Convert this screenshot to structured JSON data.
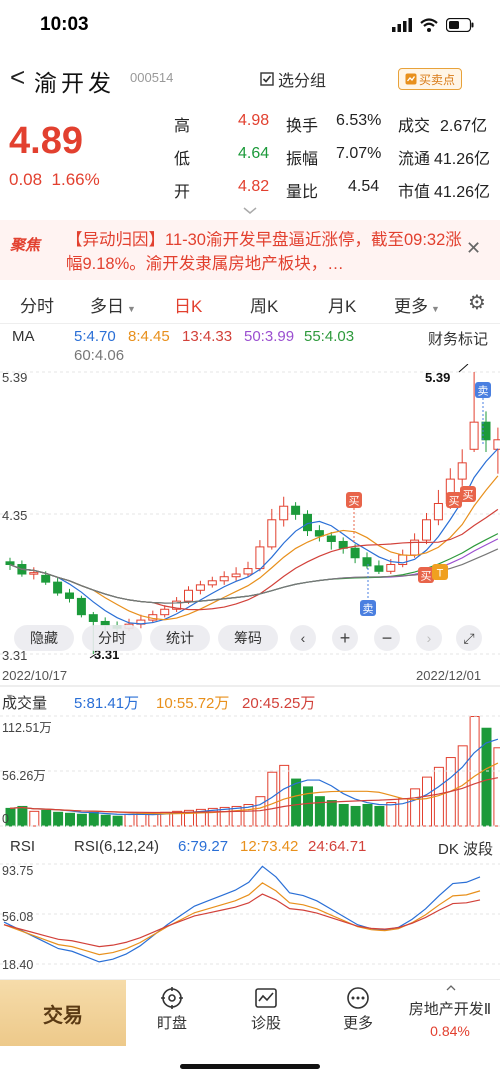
{
  "status": {
    "time": "10:03"
  },
  "header": {
    "back": "<",
    "name": "渝开发",
    "code": "000514",
    "pick_label": "选分组",
    "trade_point_label": "买卖点"
  },
  "quote": {
    "price": "4.89",
    "change": "0.08",
    "change_pct": "1.66%",
    "rows": [
      {
        "k1": "高",
        "v1": "4.98",
        "k2": "换手",
        "v2": "6.53%",
        "k3": "成交",
        "v3": "2.67亿"
      },
      {
        "k1": "低",
        "v1": "4.64",
        "k2": "振幅",
        "v2": "7.07%",
        "k3": "流通",
        "v3": "41.26亿"
      },
      {
        "k1": "开",
        "v1": "4.82",
        "k2": "量比",
        "v2": "4.54",
        "k3": "市值",
        "v3": "41.26亿"
      }
    ]
  },
  "alert": {
    "tag": "聚焦",
    "text": "【异动归因】11-30渝开发早盘逼近涨停，截至09:32涨幅9.18%。渝开发隶属房地产板块，…"
  },
  "tabs": [
    "分时",
    "多日",
    "日K",
    "周K",
    "月K",
    "更多"
  ],
  "ma": {
    "label": "MA",
    "items": [
      {
        "text": "5:4.70",
        "color": "#2a6fd6"
      },
      {
        "text": "8:4.45",
        "color": "#e8901c"
      },
      {
        "text": "13:4.33",
        "color": "#d2413a"
      },
      {
        "text": "50:3.99",
        "color": "#9b4fd0"
      },
      {
        "text": "55:4.03",
        "color": "#2e9a3c"
      },
      {
        "text": "60:4.06",
        "color": "#777777"
      }
    ],
    "finance_mark": "财务标记"
  },
  "chart_labels": {
    "price_high": "5.39",
    "price_mid": "4.35",
    "price_low": "3.31",
    "peak_label": "5.39",
    "trough_label": "3.31",
    "date_start": "2022/10/17",
    "date_end": "2022/12/01",
    "buy": "买",
    "sell": "卖",
    "t": "T"
  },
  "toolbar": {
    "hide": "隐藏",
    "intraday": "分时",
    "stats": "统计",
    "chips": "筹码"
  },
  "volume": {
    "label": "成交量",
    "items": [
      {
        "text": "5:81.41万",
        "color": "#2a6fd6"
      },
      {
        "text": "10:55.72万",
        "color": "#e8901c"
      },
      {
        "text": "20:45.25万",
        "color": "#d2413a"
      }
    ],
    "y_top": "112.51万",
    "y_mid": "56.26万",
    "y_low": "0"
  },
  "rsi": {
    "label": "RSI",
    "items": [
      {
        "text": "RSI(6,12,24)",
        "color": "#333333"
      },
      {
        "text": "6:79.27",
        "color": "#2a6fd6"
      },
      {
        "text": "12:73.42",
        "color": "#e8901c"
      },
      {
        "text": "24:64.71",
        "color": "#d2413a"
      }
    ],
    "dk": "DK 波段",
    "y_top": "93.75",
    "y_mid": "56.08",
    "y_low": "18.40"
  },
  "bottom": {
    "trade": "交易",
    "items": [
      "盯盘",
      "诊股",
      "更多"
    ],
    "peer_name": "房地产开发Ⅱ",
    "peer_change": "0.84%"
  },
  "colors": {
    "up": "#e2402f",
    "down": "#1c9a3a"
  }
}
